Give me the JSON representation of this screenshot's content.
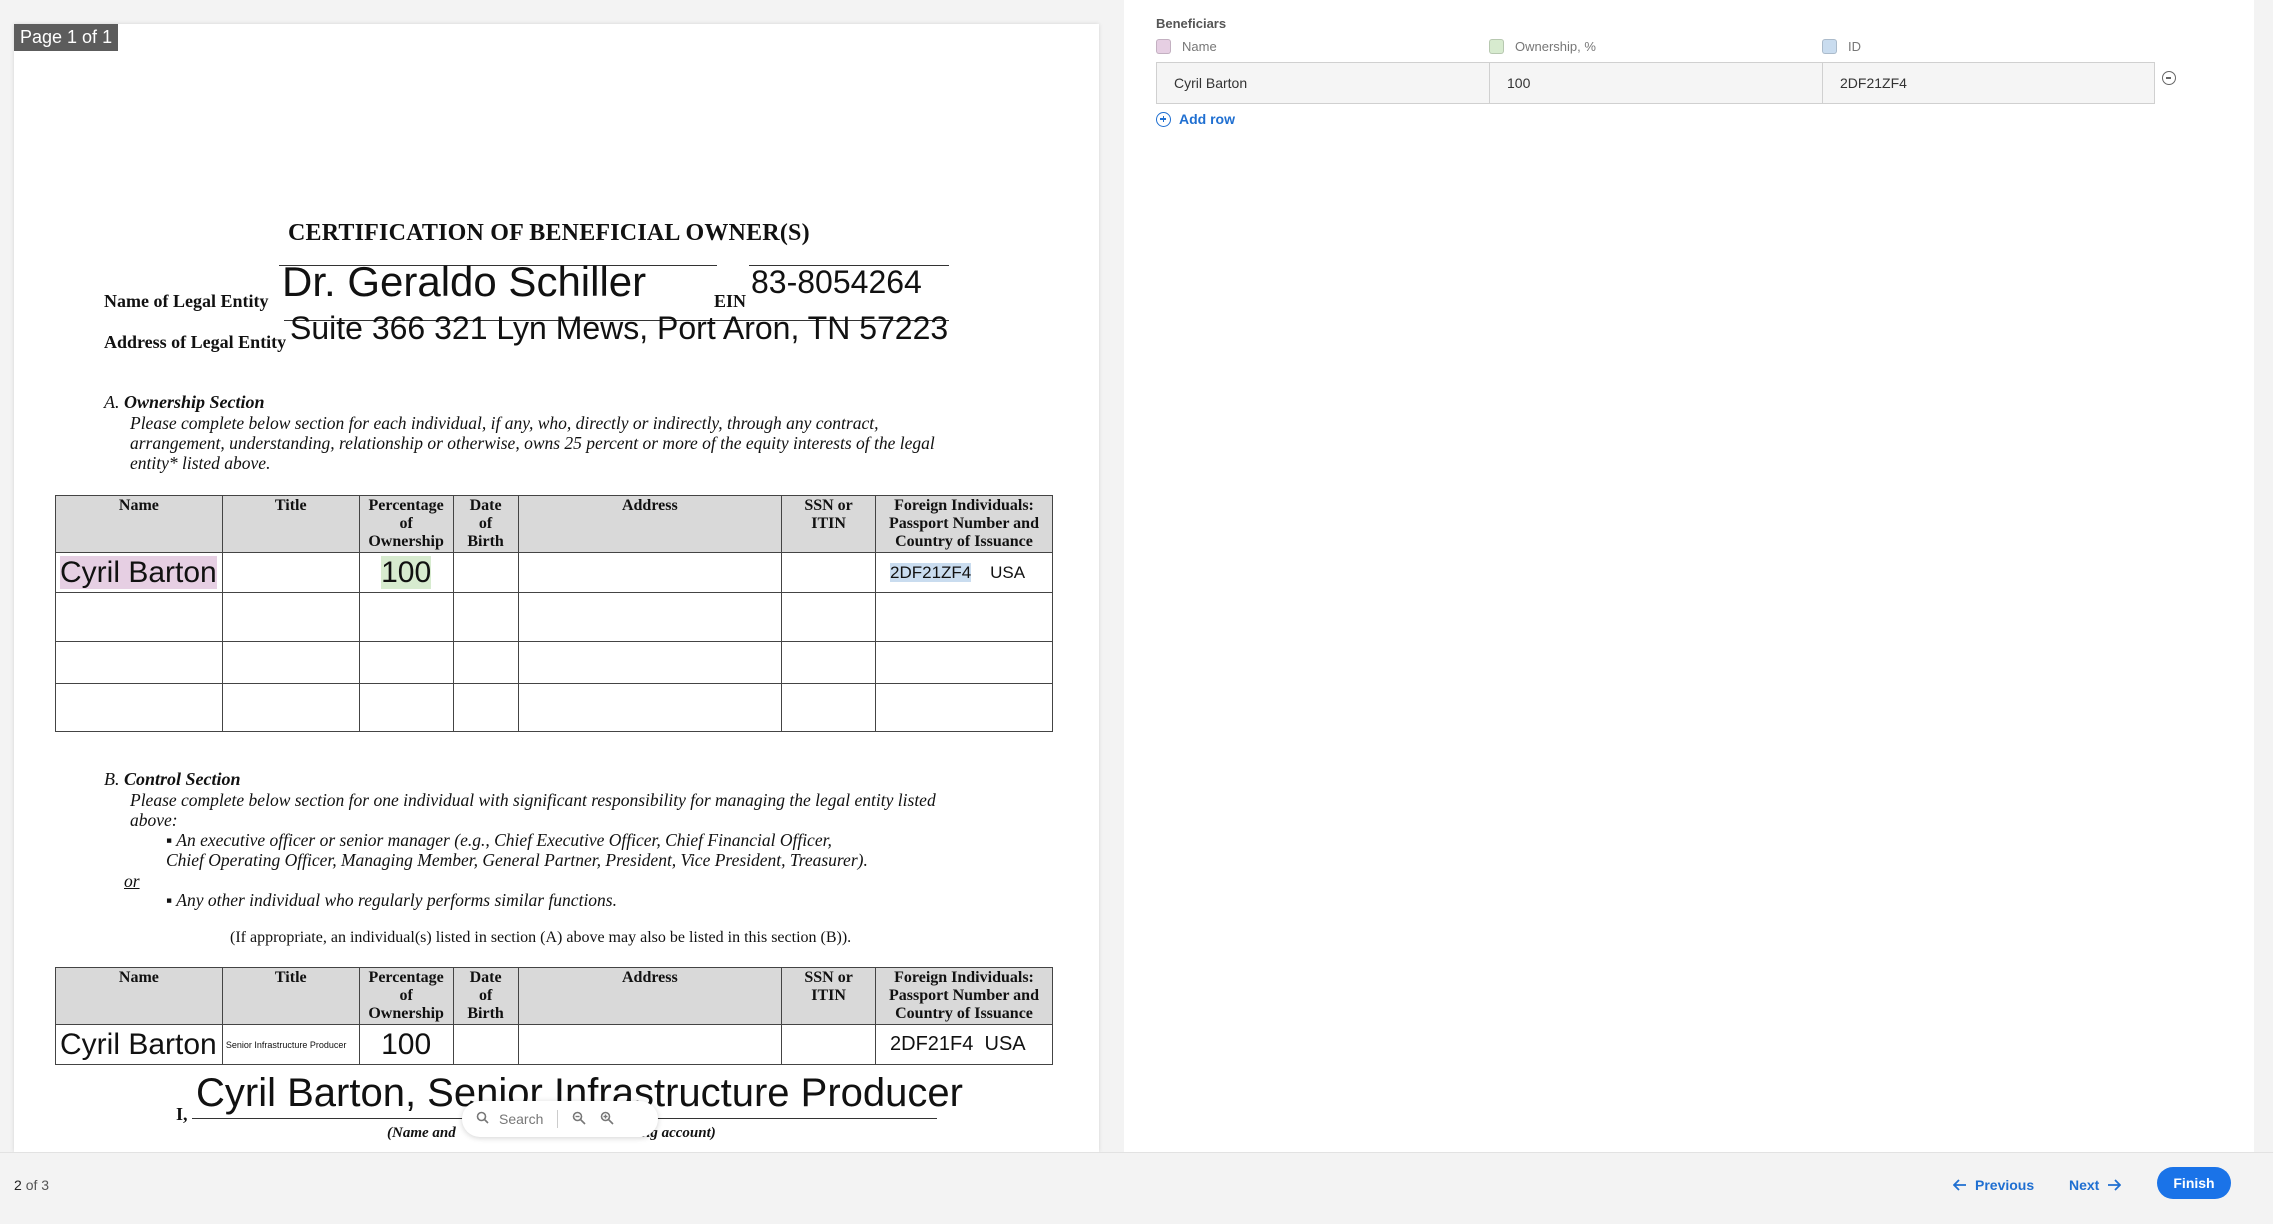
{
  "viewer": {
    "page_indicator": "Page 1 of 1",
    "search_placeholder": "Search"
  },
  "document": {
    "title": "CERTIFICATION OF BENEFICIAL OWNER(S)",
    "legal_entity_label": "Name of Legal Entity",
    "legal_entity_value": "Dr. Geraldo Schiller",
    "ein_label": "EIN",
    "ein_value": "83-8054264",
    "address_label": "Address of Legal Entity",
    "address_value": "Suite 366 321 Lyn Mews, Port Aron, TN 57223",
    "section_a": {
      "prefix": "A.",
      "title": "Ownership Section",
      "line1": "Please complete below section for each individual, if any, who, directly or indirectly, through any contract,",
      "line2": "arrangement, understanding, relationship or otherwise, owns 25 percent or more of the equity interests of the legal",
      "line3": "entity* listed above."
    },
    "table_headers": {
      "name": "Name",
      "title": "Title",
      "pct_1": "Percentage",
      "pct_2": "of",
      "pct_3": "Ownership",
      "dob_1": "Date",
      "dob_2": "of",
      "dob_3": "Birth",
      "address": "Address",
      "ssn_1": "SSN or",
      "ssn_2": "ITIN",
      "foreign_1": "Foreign Individuals:",
      "foreign_2": "Passport Number and",
      "foreign_3": "Country of Issuance"
    },
    "ownership_row": {
      "name": "Cyril Barton",
      "ownership": "100",
      "passport": "2DF21ZF4",
      "country": "USA"
    },
    "section_b": {
      "prefix": "B.",
      "title": "Control Section",
      "line1": "Please complete below section for one individual with significant responsibility for managing the legal entity listed",
      "line2": "above:",
      "bullet1_line1": "An executive officer or senior manager (e.g., Chief Executive Officer, Chief Financial Officer,",
      "bullet1_line2": "Chief Operating Officer, Managing Member, General Partner, President, Vice President, Treasurer).",
      "or": "or",
      "bullet2": "Any other individual who regularly performs similar functions.",
      "note": "(If appropriate, an individual(s) listed in section (A) above may also be listed in this section (B))."
    },
    "control_row": {
      "name": "Cyril Barton",
      "title": "Senior Infrastructure Producer",
      "ownership": "100",
      "passport": "2DF21F4",
      "country": "USA"
    },
    "signature": {
      "prefix": "I,",
      "value": "Cyril Barton, Senior Infrastructure Producer",
      "caption_start": "(Name and",
      "caption_end": "ng account)"
    }
  },
  "panel": {
    "title": "Beneficiars",
    "columns": [
      {
        "label": "Name",
        "color": "#e6cfe3"
      },
      {
        "label": "Ownership, %",
        "color": "#d7ebcf"
      },
      {
        "label": "ID",
        "color": "#c9dcef"
      }
    ],
    "rows": [
      {
        "name": "Cyril Barton",
        "ownership": "100",
        "id": "2DF21ZF4"
      }
    ],
    "add_row_label": "Add row"
  },
  "footer": {
    "current": "2",
    "of_total": "of 3",
    "previous_label": "Previous",
    "next_label": "Next",
    "finish_label": "Finish"
  }
}
